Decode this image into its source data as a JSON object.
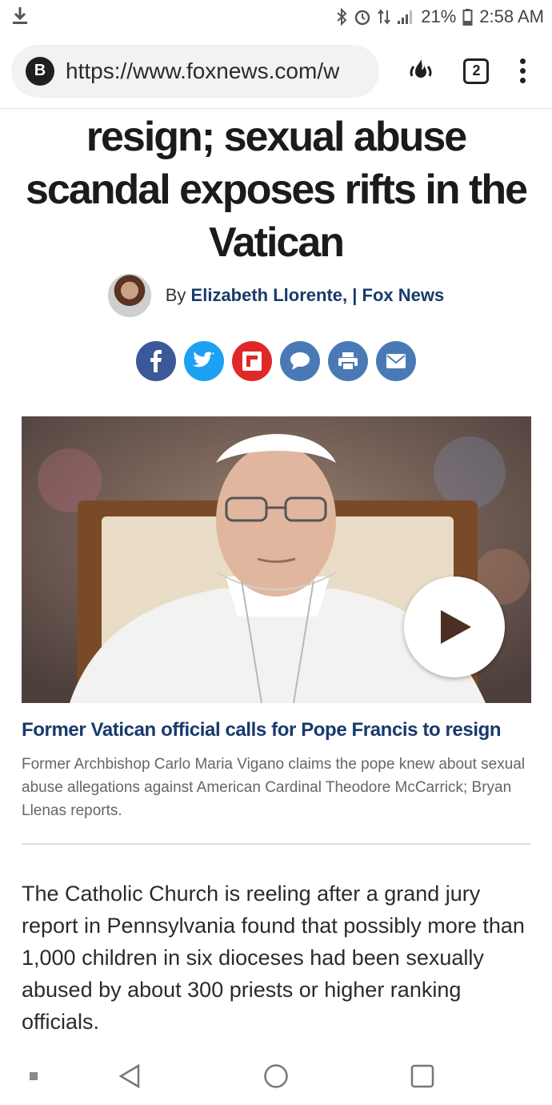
{
  "status_bar": {
    "battery": "21%",
    "time": "2:58 AM",
    "icons": [
      "download-icon",
      "bluetooth-icon",
      "alarm-icon",
      "data-icon",
      "signal-icon",
      "battery-icon"
    ]
  },
  "browser": {
    "site_badge": "B",
    "url": "https://www.foxnews.com/w",
    "tab_count": "2",
    "icons": [
      "fire-icon",
      "tabs-icon",
      "menu-icon"
    ]
  },
  "article": {
    "headline": "resign; sexual abuse scandal exposes rifts in the Vatican",
    "byline_prefix": "By",
    "author": "Elizabeth Llorente,",
    "separator": "|",
    "outlet": "Fox News",
    "share_buttons": [
      {
        "name": "facebook",
        "color": "#3b5998"
      },
      {
        "name": "twitter",
        "color": "#1da1f2"
      },
      {
        "name": "flipboard",
        "color": "#e12828"
      },
      {
        "name": "comments",
        "color": "#4a7ab6"
      },
      {
        "name": "print",
        "color": "#4a7ab6"
      },
      {
        "name": "email",
        "color": "#4a7ab6"
      }
    ],
    "video": {
      "caption_title": "Former Vatican official calls for Pope Francis to resign",
      "caption_description": "Former Archbishop Carlo Maria Vigano claims the pope knew about sexual abuse allegations against American Cardinal Theodore McCarrick; Bryan Llenas reports."
    },
    "body": "The Catholic Church is reeling after a grand jury report in Pennsylvania found that possibly more than 1,000 children in six dioceses had been sexually abused by about 300 priests or higher ranking officials."
  },
  "nav_bar": {
    "icons": [
      "recent-dot-icon",
      "back-icon",
      "home-icon",
      "overview-icon"
    ]
  },
  "colors": {
    "link_blue": "#183a6b",
    "headline": "#1b1b1b"
  }
}
